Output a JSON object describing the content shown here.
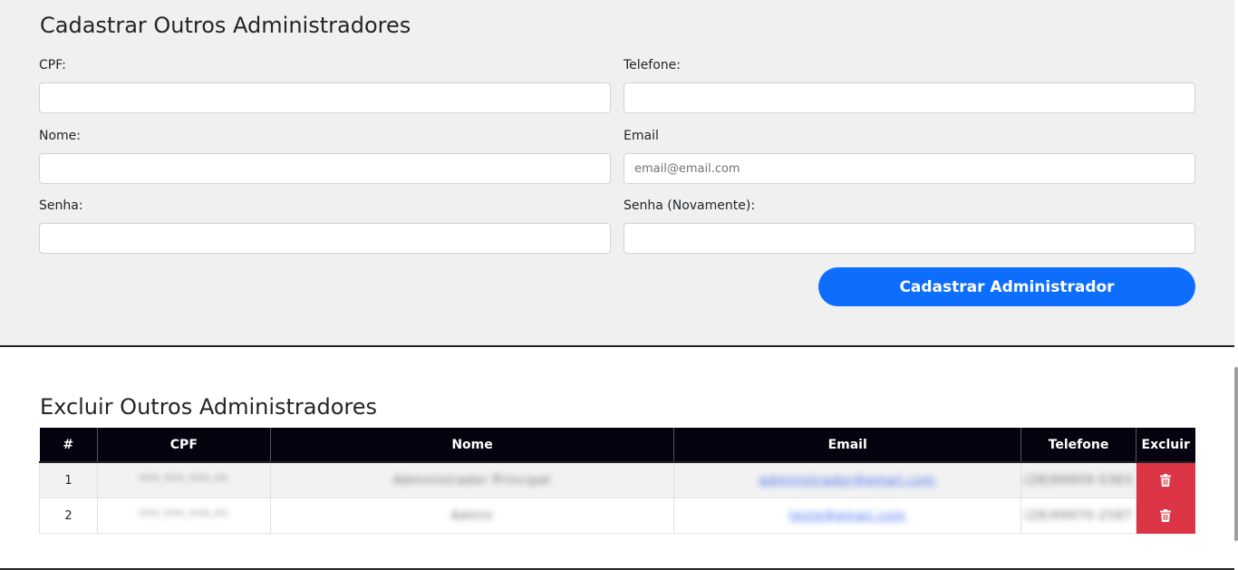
{
  "register": {
    "title": "Cadastrar Outros Administradores",
    "fields": {
      "cpf": {
        "label": "CPF:",
        "value": "",
        "placeholder": ""
      },
      "telefone": {
        "label": "Telefone:",
        "value": "",
        "placeholder": ""
      },
      "nome": {
        "label": "Nome:",
        "value": "",
        "placeholder": ""
      },
      "email": {
        "label": "Email",
        "value": "",
        "placeholder": "email@email.com"
      },
      "senha": {
        "label": "Senha:",
        "value": "",
        "placeholder": ""
      },
      "senha_novamente": {
        "label": "Senha (Novamente):",
        "value": "",
        "placeholder": ""
      }
    },
    "submit_label": "Cadastrar Administrador",
    "accent_color": "#0d6efd"
  },
  "delete_section": {
    "title": "Excluir Outros Administradores",
    "columns": [
      "#",
      "CPF",
      "Nome",
      "Email",
      "Telefone",
      "Excluir"
    ],
    "rows": [
      {
        "index": "1",
        "cpf": "***.***.***-**",
        "nome": "Administrador Principal",
        "email": "administrador@email.com",
        "telefone": "(28)99959-5363",
        "delete_icon": "trash-icon"
      },
      {
        "index": "2",
        "cpf": "***.***.***-**",
        "nome": "Admin",
        "email": "teste@email.com",
        "telefone": "(28)99970-2587",
        "delete_icon": "trash-icon"
      }
    ],
    "header_color": "#06020f",
    "danger_color": "#dc3545"
  }
}
